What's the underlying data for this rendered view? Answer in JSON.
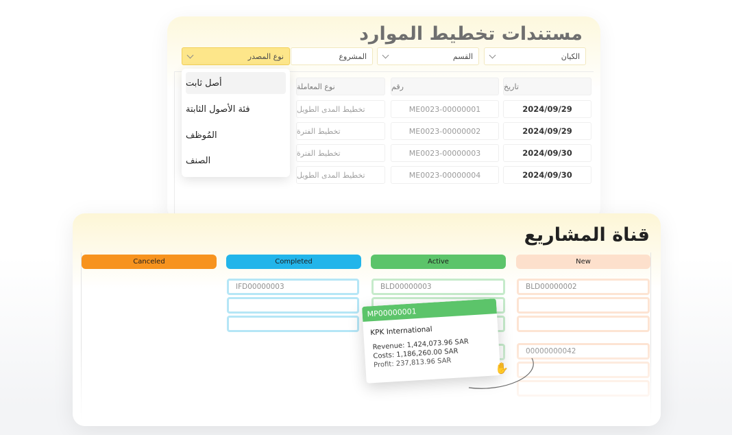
{
  "resource_planning": {
    "title": "مستندات تخطيط الموارد",
    "filters": {
      "entity": "الكيان",
      "department": "القسم",
      "project": "المشروع",
      "source_type": "نوع المصدر"
    },
    "columns": {
      "date": "تاريخ",
      "number": "رقم",
      "transaction_type": "نوع المعاملة"
    },
    "rows": [
      {
        "date": "2024/09/29",
        "number": "ME0023-00000001",
        "type": "تخطيط المدى الطويل"
      },
      {
        "date": "2024/09/29",
        "number": "ME0023-00000002",
        "type": "تخطيط الفترة"
      },
      {
        "date": "2024/09/30",
        "number": "ME0023-00000003",
        "type": "تخطيط الفترة"
      },
      {
        "date": "2024/09/30",
        "number": "ME0023-00000004",
        "type": "تخطيط المدى الطويل"
      }
    ],
    "dropdown_options": [
      "أصل ثابت",
      "فئة الأصول الثابتة",
      "المُوظف",
      "الصنف"
    ]
  },
  "pipeline": {
    "title": "قناة المشاريع",
    "columns": [
      {
        "label": "Canceled",
        "color": "#f7931e",
        "items": []
      },
      {
        "label": "Completed",
        "color": "#22b5ea",
        "items": [
          "IFD00000003",
          "",
          ""
        ]
      },
      {
        "label": "Active",
        "color": "#5cc46a",
        "items": [
          "BLD00000003",
          "",
          ""
        ]
      },
      {
        "label": "New",
        "color": "#fde0cc",
        "items": [
          "BLD00000002",
          "",
          "",
          "00000000042",
          ""
        ]
      }
    ],
    "floating_card": {
      "id": "MP00000001",
      "name": "KPK International",
      "revenue": "Revenue: 1,424,073.96 SAR",
      "costs": "Costs: 1,186,260.00 SAR",
      "profit": "Profit: 237,813.96 SAR"
    },
    "icons": {
      "drag": "hand-pointer-icon"
    }
  }
}
